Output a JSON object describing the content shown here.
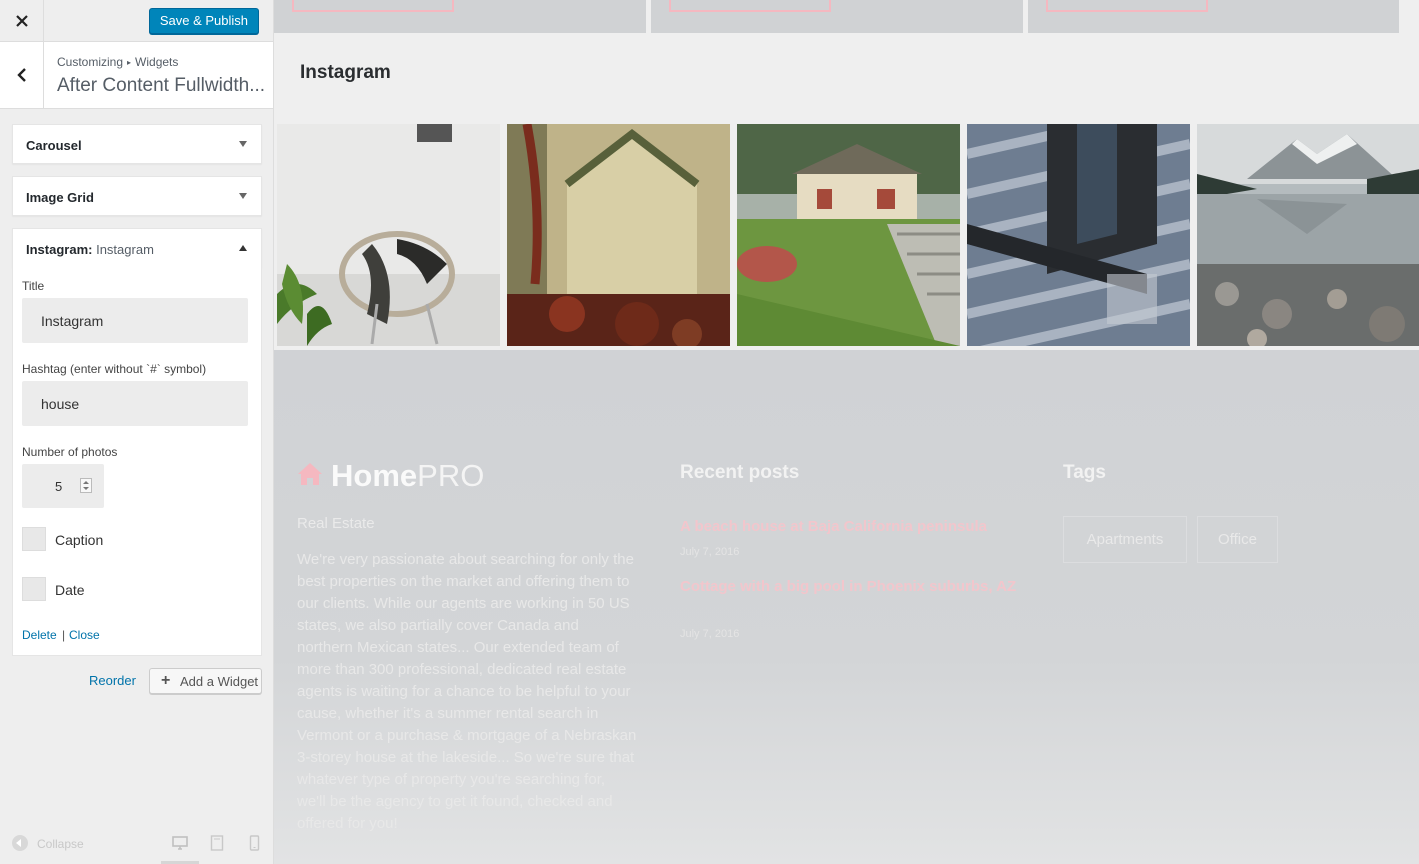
{
  "topbar": {
    "close_icon": "close-icon",
    "save_label": "Save & Publish",
    "accent": "#0085ba"
  },
  "section": {
    "breadcrumb_parent": "Customizing",
    "breadcrumb_child": "Widgets",
    "title": "After Content Fullwidth..."
  },
  "widgets": [
    {
      "name": "Carousel",
      "expanded": false
    },
    {
      "name": "Image Grid",
      "expanded": false
    },
    {
      "name": "Instagram:",
      "subtitle": "Instagram",
      "expanded": true
    }
  ],
  "instagram_form": {
    "title_label": "Title",
    "title_value": "Instagram",
    "hashtag_label": "Hashtag (enter without `#` symbol)",
    "hashtag_value": "house",
    "photos_label": "Number of photos",
    "photos_value": "5",
    "caption_label": "Caption",
    "caption_checked": false,
    "date_label": "Date",
    "date_checked": false,
    "delete_label": "Delete",
    "separator": "|",
    "close_label": "Close"
  },
  "actions": {
    "reorder_label": "Reorder",
    "add_widget_label": "Add a Widget"
  },
  "footer_controls": {
    "collapse_label": "Collapse",
    "devices": [
      "desktop-icon",
      "tablet-icon",
      "mobile-icon"
    ],
    "active_device": "desktop"
  },
  "preview": {
    "instagram_heading": "Instagram",
    "photo_count": 5,
    "logo_bold": "Home",
    "logo_light": "PRO",
    "tagline": "Real Estate",
    "about": "We're very passionate about searching for only the best properties on the market and offering them to our clients. While our agents are working in 50 US states, we also partially cover Canada and northern Mexican states... Our extended team of more than 300 professional, dedicated real estate agents is waiting for a chance to be helpful to your cause, whether it's a summer rental search in Vermont or a purchase & mortgage of a Nebraskan 3-storey house at the lakeside... So we're sure that whatever type of property you're searching for, we'll be the agency to get it found, checked and offered for you!",
    "recent_posts_heading": "Recent posts",
    "posts": [
      {
        "title": "A beach house at Baja California peninsula",
        "date": "July 7, 2016"
      },
      {
        "title": "Cottage with a big pool in Phoenix suburbs, AZ",
        "date": "July 7, 2016"
      }
    ],
    "tags_heading": "Tags",
    "tags": [
      "Apartments",
      "Office"
    ],
    "brand_color": "#f5b8c0"
  }
}
